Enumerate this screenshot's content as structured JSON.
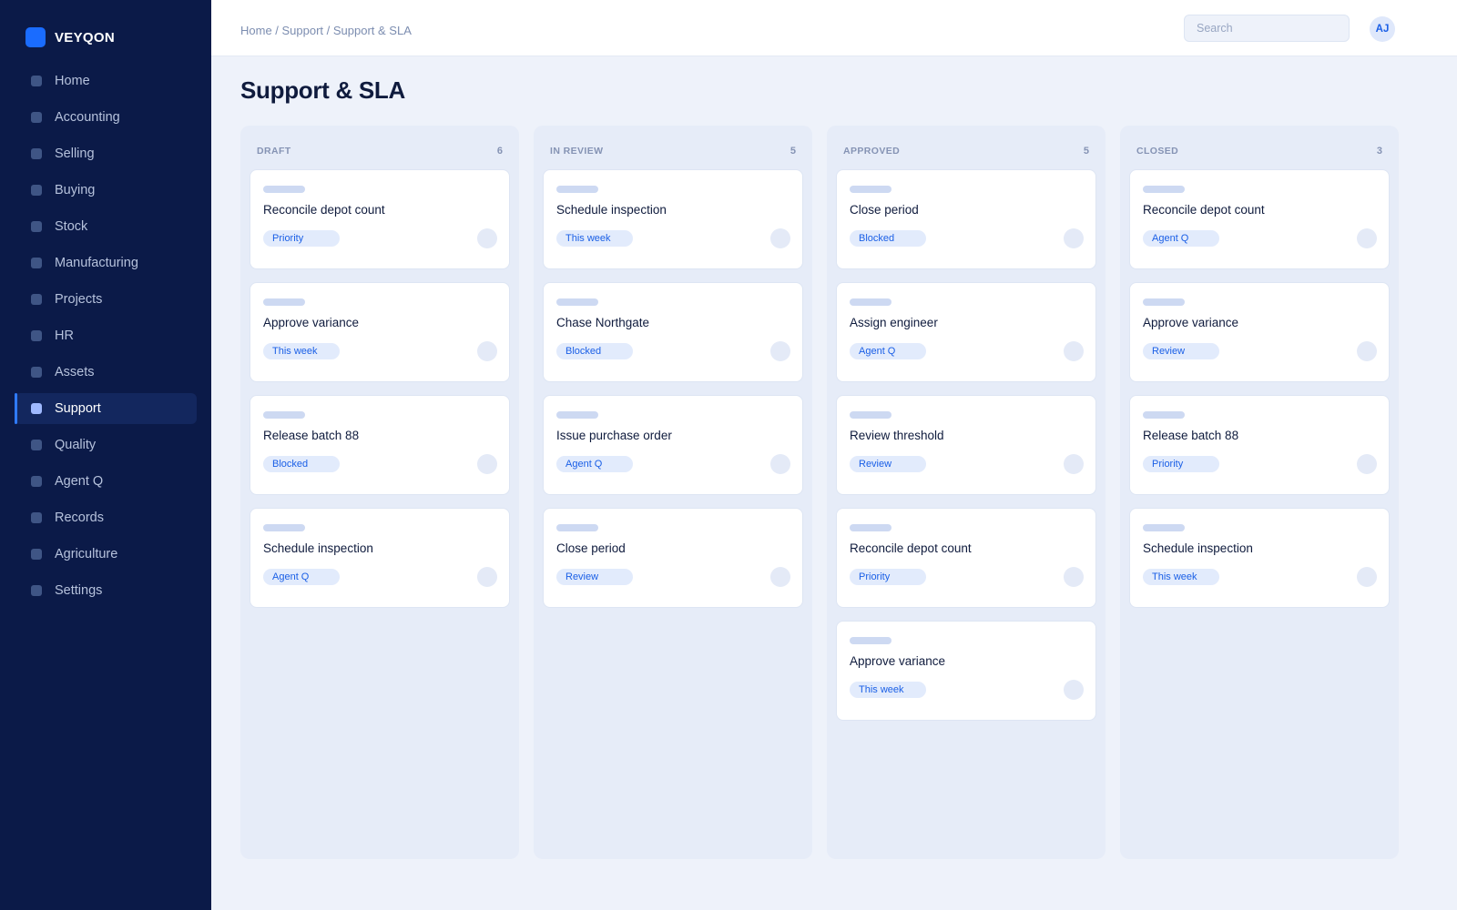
{
  "brand": {
    "name": "VEYQON",
    "accent": "#1a6cff"
  },
  "sidebar": {
    "items": [
      {
        "label": "Home",
        "active": false
      },
      {
        "label": "Accounting",
        "active": false
      },
      {
        "label": "Selling",
        "active": false
      },
      {
        "label": "Buying",
        "active": false
      },
      {
        "label": "Stock",
        "active": false
      },
      {
        "label": "Manufacturing",
        "active": false
      },
      {
        "label": "Projects",
        "active": false
      },
      {
        "label": "HR",
        "active": false
      },
      {
        "label": "Assets",
        "active": false
      },
      {
        "label": "Support",
        "active": true
      },
      {
        "label": "Quality",
        "active": false
      },
      {
        "label": "Agent Q",
        "active": false
      },
      {
        "label": "Records",
        "active": false
      },
      {
        "label": "Agriculture",
        "active": false
      },
      {
        "label": "Settings",
        "active": false
      }
    ]
  },
  "header": {
    "breadcrumb": "Home / Support / Support & SLA",
    "search_placeholder": "Search",
    "avatar_initials": "AJ"
  },
  "page": {
    "title": "Support & SLA"
  },
  "board": {
    "columns": [
      {
        "title": "DRAFT",
        "count": "6",
        "cards": [
          {
            "title": "Reconcile depot count",
            "tag": "Priority"
          },
          {
            "title": "Approve variance",
            "tag": "This week"
          },
          {
            "title": "Release batch 88",
            "tag": "Blocked"
          },
          {
            "title": "Schedule inspection",
            "tag": "Agent Q"
          }
        ]
      },
      {
        "title": "IN REVIEW",
        "count": "5",
        "cards": [
          {
            "title": "Schedule inspection",
            "tag": "This week"
          },
          {
            "title": "Chase Northgate",
            "tag": "Blocked"
          },
          {
            "title": "Issue purchase order",
            "tag": "Agent Q"
          },
          {
            "title": "Close period",
            "tag": "Review"
          }
        ]
      },
      {
        "title": "APPROVED",
        "count": "5",
        "cards": [
          {
            "title": "Close period",
            "tag": "Blocked"
          },
          {
            "title": "Assign engineer",
            "tag": "Agent Q"
          },
          {
            "title": "Review threshold",
            "tag": "Review"
          },
          {
            "title": "Reconcile depot count",
            "tag": "Priority"
          },
          {
            "title": "Approve variance",
            "tag": "This week"
          }
        ]
      },
      {
        "title": "CLOSED",
        "count": "3",
        "cards": [
          {
            "title": "Reconcile depot count",
            "tag": "Agent Q"
          },
          {
            "title": "Approve variance",
            "tag": "Review"
          },
          {
            "title": "Release batch 88",
            "tag": "Priority"
          },
          {
            "title": "Schedule inspection",
            "tag": "This week"
          }
        ]
      }
    ]
  }
}
